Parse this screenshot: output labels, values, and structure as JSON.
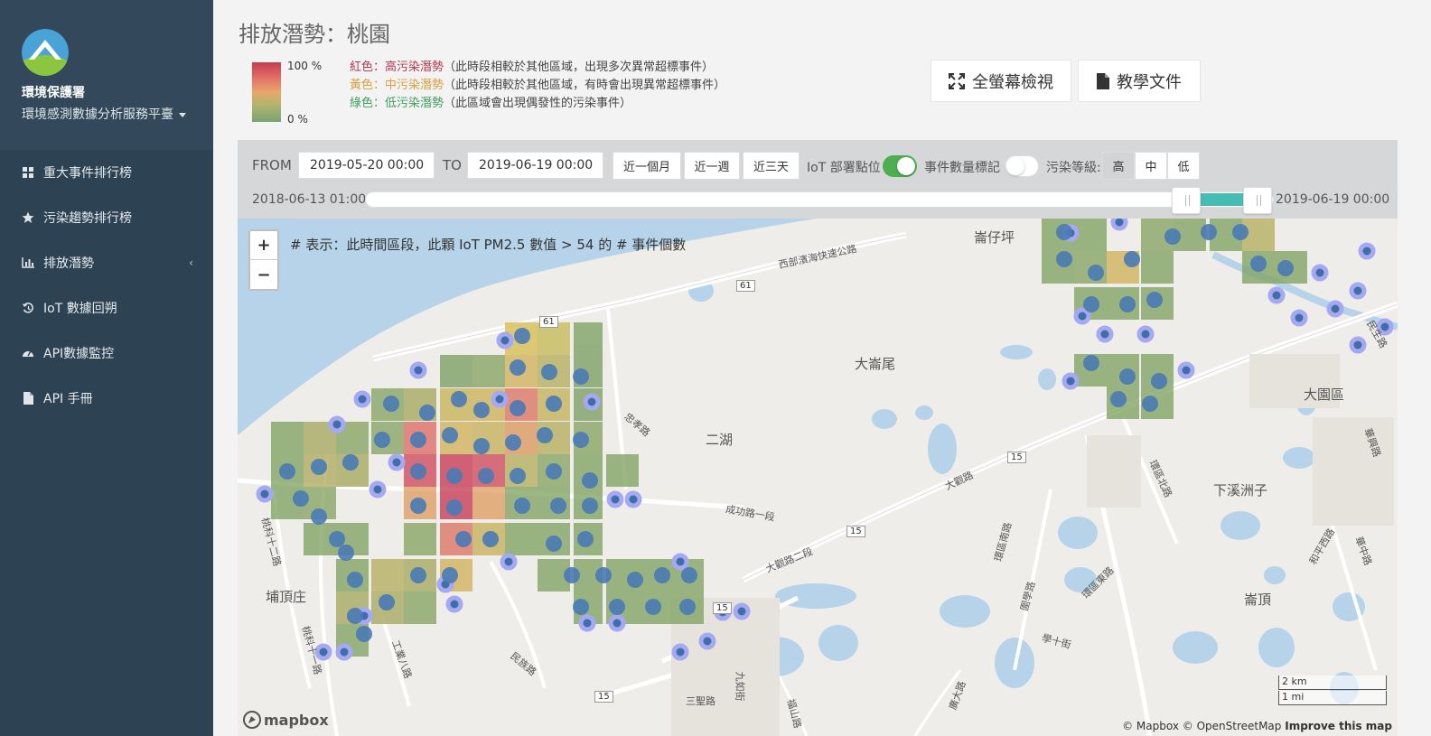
{
  "sidebar": {
    "brand_name": "環境保護署",
    "brand_sub": "環境感測數據分析服務平臺",
    "items": [
      {
        "label": "重大事件排行榜",
        "icon": "grid-icon"
      },
      {
        "label": "污染趨勢排行榜",
        "icon": "star-icon"
      },
      {
        "label": "排放潛勢",
        "icon": "bar-chart-icon"
      },
      {
        "label": "IoT 數據回朔",
        "icon": "history-icon"
      },
      {
        "label": "API數據監控",
        "icon": "dashboard-icon"
      },
      {
        "label": "API 手冊",
        "icon": "document-icon"
      }
    ]
  },
  "header": {
    "title": "排放潛勢：桃園",
    "fullscreen_label": "全螢幕檢視",
    "docs_label": "教學文件"
  },
  "legend": {
    "max_label": "100 %",
    "min_label": "0 %",
    "red_label": "紅色：高污染潛勢",
    "red_desc": "（此時段相較於其他區域，出現多次異常超標事件）",
    "yellow_label": "黃色：中污染潛勢",
    "yellow_desc": "（此時段相較於其他區域，有時會出現異常超標事件）",
    "green_label": "綠色：低污染潛勢",
    "green_desc": "（此區域會出現偶發性的污染事件）",
    "colors": {
      "red": "#b1374a",
      "yellow": "#d4a03c",
      "green": "#3e9c5e"
    }
  },
  "filters": {
    "from_label": "FROM",
    "from_value": "2019-05-20 00:00",
    "to_label": "TO",
    "to_value": "2019-06-19 00:00",
    "quick": [
      "近一個月",
      "近一週",
      "近三天"
    ],
    "iot_label": "IoT 部署點位",
    "iot_on": true,
    "event_label": "事件數量標記",
    "event_on": false,
    "level_label": "污染等級:",
    "levels": [
      "高",
      "中",
      "低"
    ],
    "level_selected": "高",
    "range_start": "2018-06-13 01:00",
    "range_end": "2019-06-19 00:00"
  },
  "map": {
    "zoom_in": "+",
    "zoom_out": "−",
    "note": "# 表示：此時間區段，此顆 IoT PM2.5 數值 > 54 的 # 事件個數",
    "places": [
      "崙仔坪",
      "大崙尾",
      "二湖",
      "大園區",
      "下溪洲子",
      "埔頂庄",
      "崙頂"
    ],
    "roads": [
      "西部濱海快速公路",
      "成功路一段",
      "大觀路二段",
      "大觀路",
      "忠孝路",
      "民族路",
      "工業八路",
      "桃科十二路",
      "桃科十一路",
      "三聖路",
      "九如街",
      "福山路",
      "圍學路",
      "環區南路",
      "環區東路",
      "學十街",
      "廣大路",
      "和平西路",
      "華興路",
      "環區北路",
      "華中路",
      "民生路"
    ],
    "shields": [
      "61",
      "61",
      "15",
      "15",
      "15",
      "15"
    ],
    "scale_km": "2 km",
    "scale_mi": "1 mi",
    "attribution_a": "© Mapbox © OpenStreetMap",
    "attribution_b": "Improve this map",
    "logo_text": "mapbox"
  }
}
